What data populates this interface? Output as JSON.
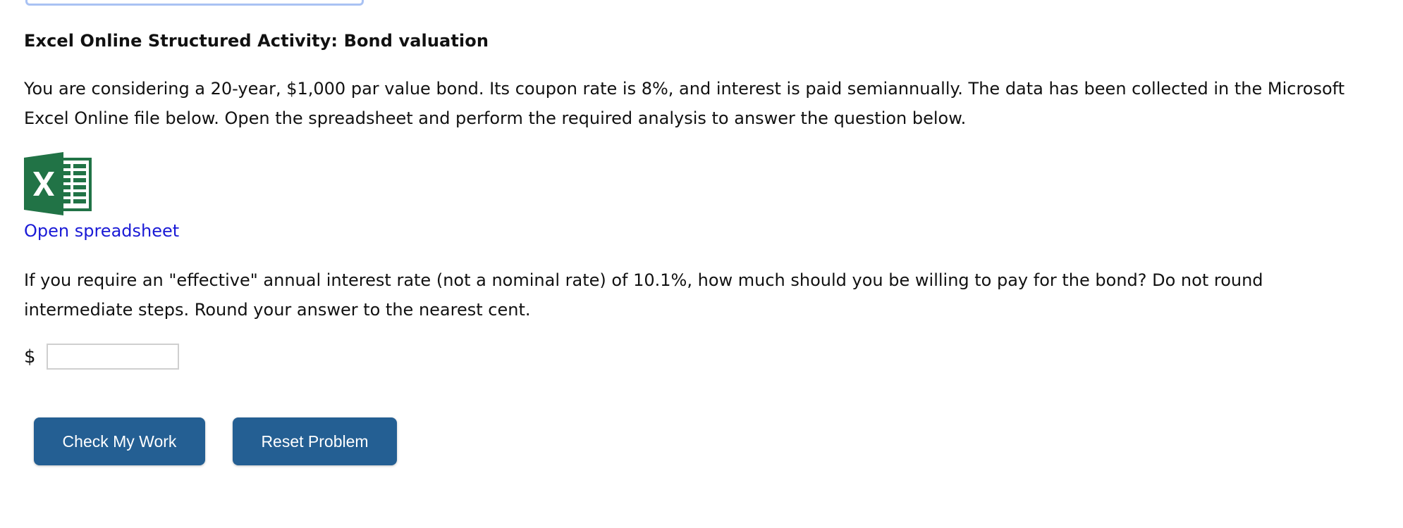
{
  "activity": {
    "title": "Excel Online Structured Activity: Bond valuation",
    "intro": "You are considering a 20-year, $1,000 par value bond. Its coupon rate is 8%, and interest is paid semiannually. The data has been collected in the Microsoft Excel Online file below. Open the spreadsheet and perform the required analysis to answer the question below.",
    "spreadsheet_link": "Open spreadsheet",
    "question": "If you require an \"effective\" annual interest rate (not a nominal rate) of 10.1%, how much should you be willing to pay for the bond? Do not round intermediate steps. Round your answer to the nearest cent."
  },
  "answer": {
    "currency_symbol": "$",
    "value": ""
  },
  "buttons": {
    "check_label": "Check My Work",
    "reset_label": "Reset Problem"
  },
  "colors": {
    "excel_green": "#217346",
    "link_blue": "#1a1ad6",
    "button_blue": "#245f93"
  },
  "icons": {
    "excel": "excel-icon"
  }
}
